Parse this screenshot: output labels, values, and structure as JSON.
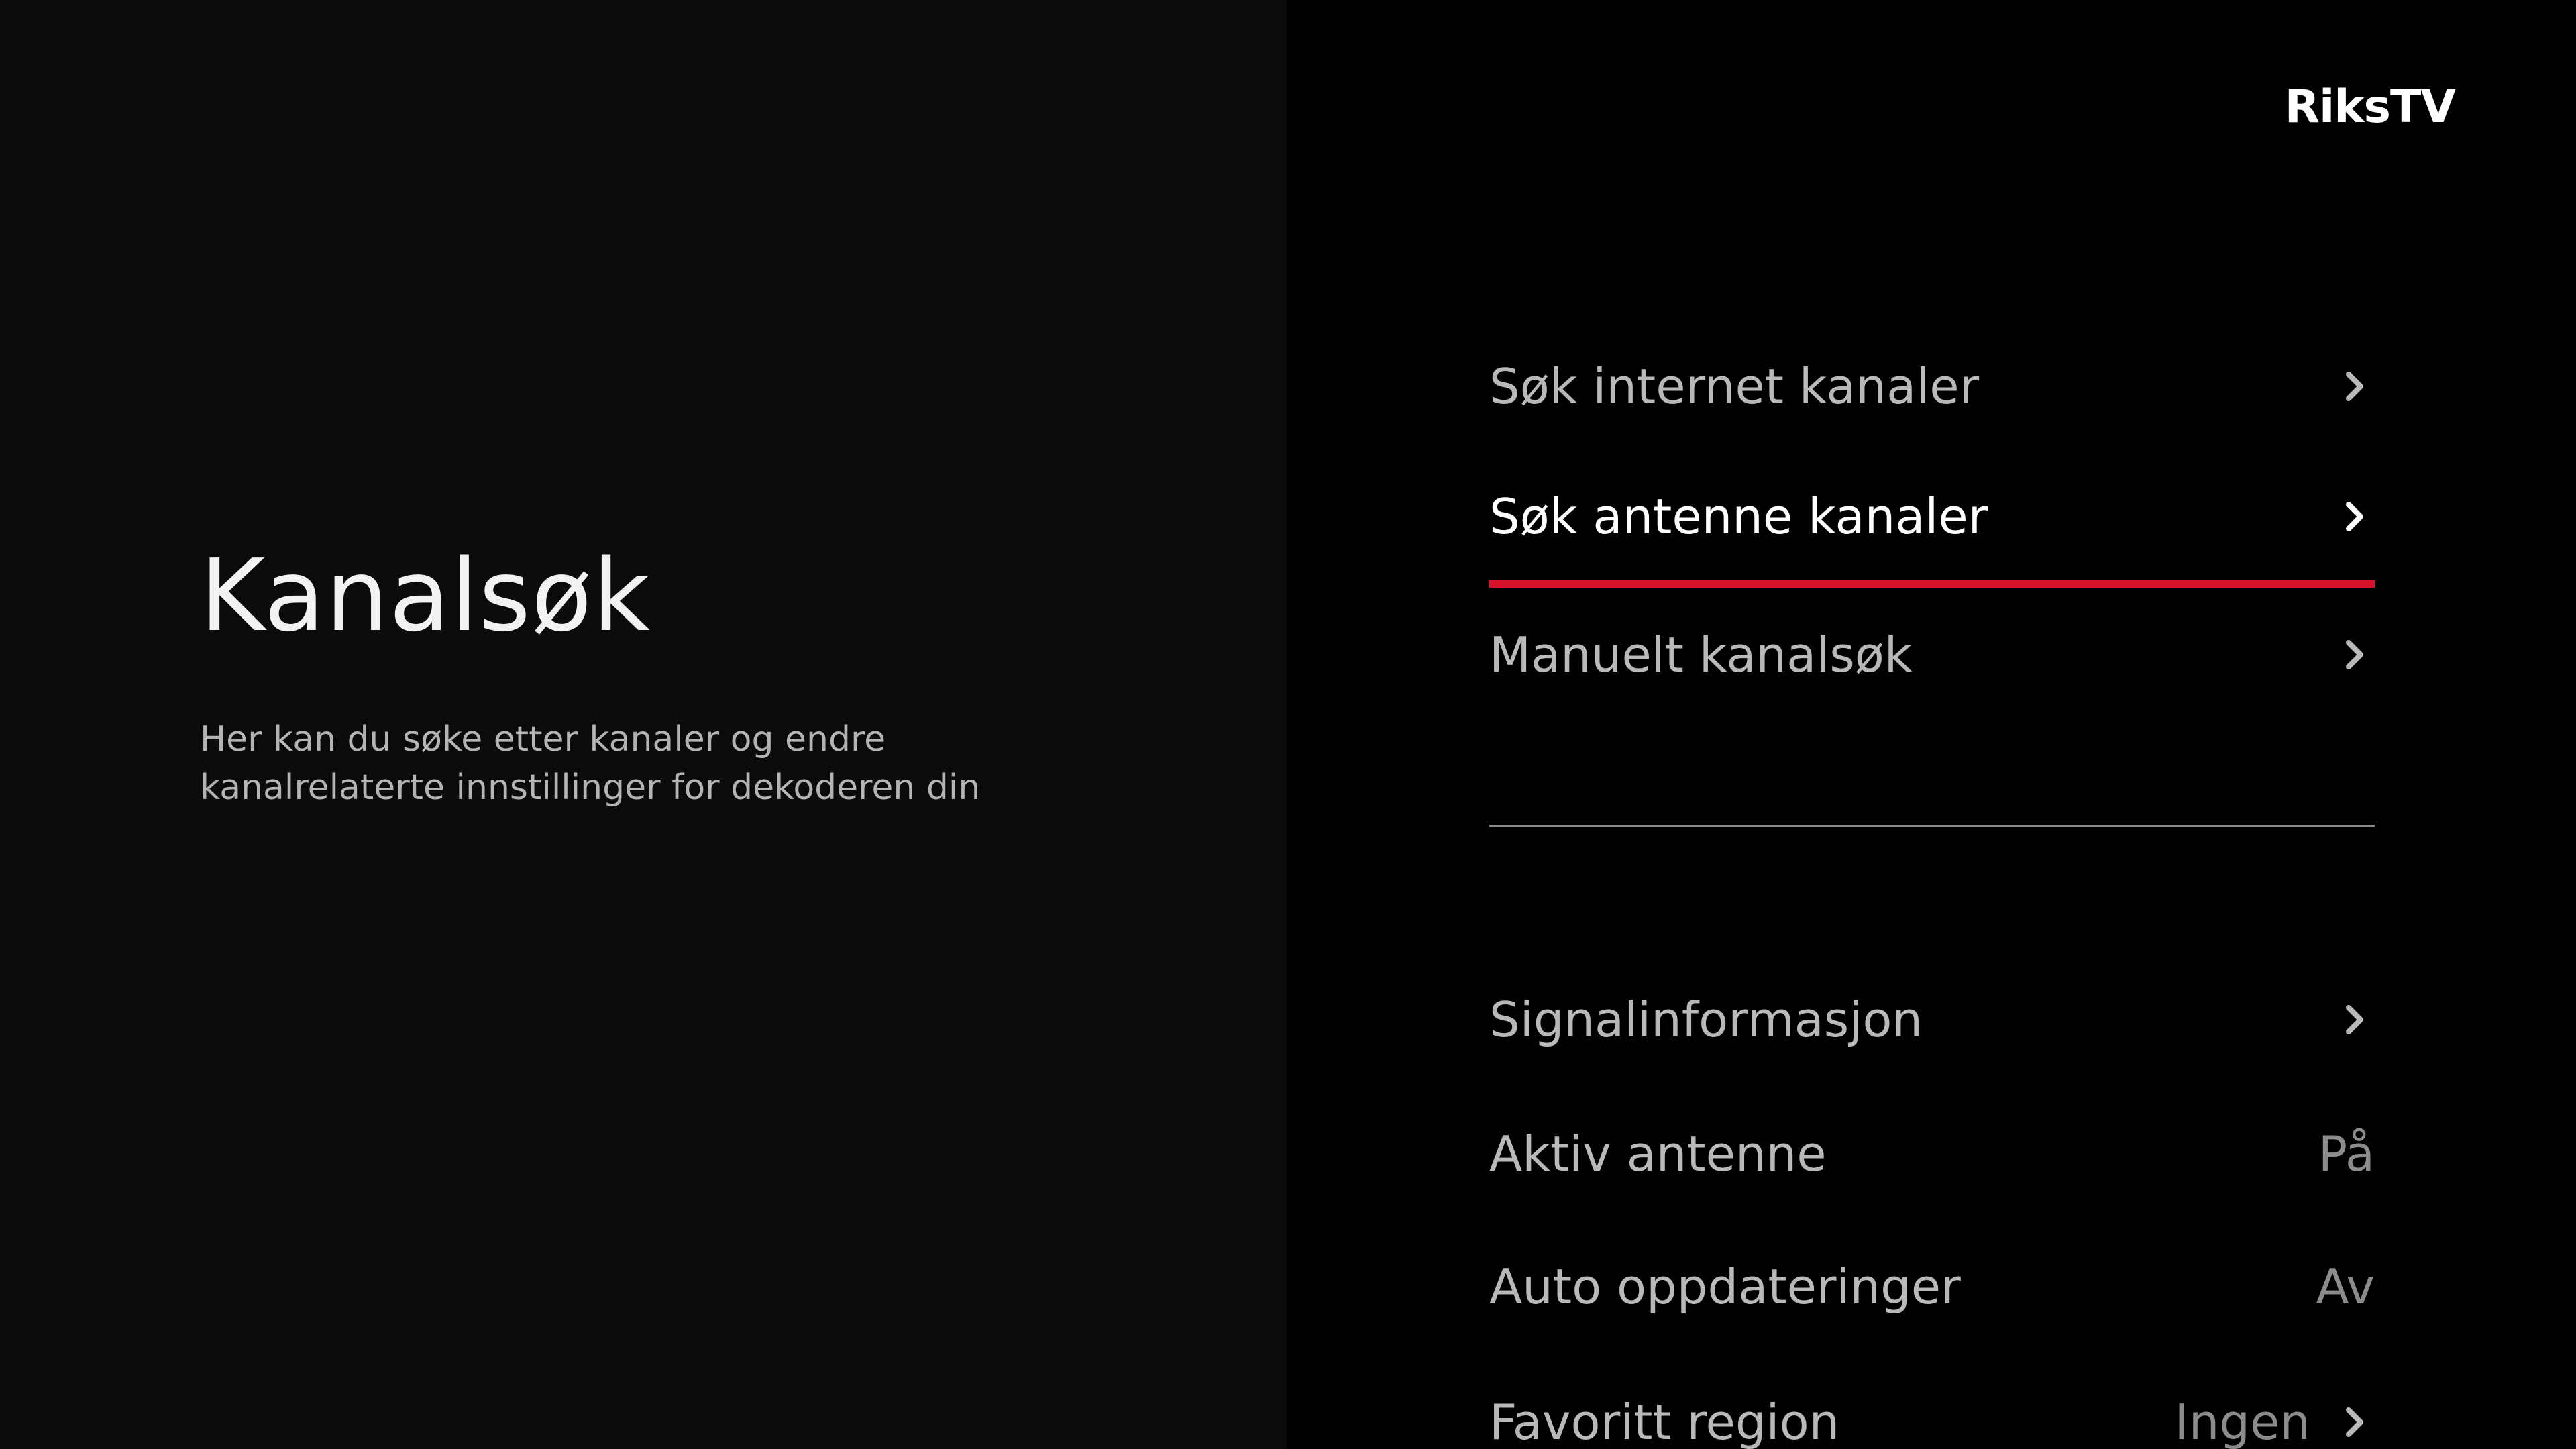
{
  "brand": "RiksTV",
  "page": {
    "title": "Kanalsøk",
    "description_lines": [
      "Her kan du søke etter kanaler og endre",
      "kanalrelaterte innstillinger for dekoderen din"
    ]
  },
  "menu": {
    "items": [
      {
        "label": "Søk internet kanaler"
      },
      {
        "label": "Søk antenne kanaler",
        "focused": true
      },
      {
        "label": "Manuelt kanalsøk"
      },
      {
        "label": "Signalinformasjon"
      },
      {
        "label": "Aktiv antenne",
        "value": "På"
      },
      {
        "label": "Auto oppdateringer",
        "value": "Av"
      },
      {
        "label": "Favoritt region",
        "value": "Ingen"
      }
    ]
  },
  "icons": {
    "chevron": "chevron-right-icon"
  },
  "colors": {
    "background_left": "#0b0b0b",
    "background_right": "#000000",
    "focus_underline": "#d4122a",
    "text_primary": "#ffffff",
    "text_secondary": "#b9b9b9"
  }
}
